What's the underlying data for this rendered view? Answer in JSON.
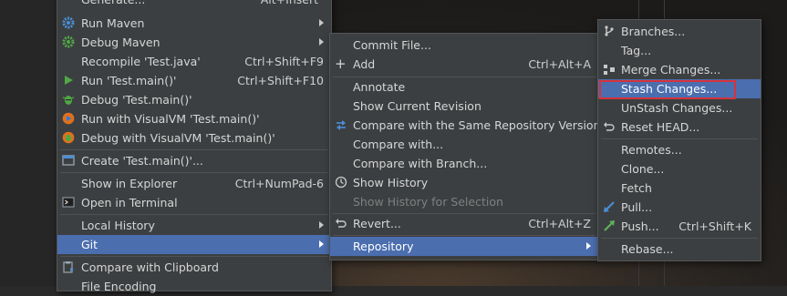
{
  "menu1": {
    "items": [
      {
        "label": "Generate...",
        "shortcut": "Alt+Insert"
      },
      {
        "label": "Run Maven"
      },
      {
        "label": "Debug Maven"
      },
      {
        "label": "Recompile 'Test.java'",
        "shortcut": "Ctrl+Shift+F9"
      },
      {
        "label": "Run 'Test.main()'",
        "shortcut": "Ctrl+Shift+F10"
      },
      {
        "label": "Debug 'Test.main()'"
      },
      {
        "label": "Run with VisualVM 'Test.main()'"
      },
      {
        "label": "Debug with VisualVM 'Test.main()'"
      },
      {
        "label": "Create 'Test.main()'..."
      },
      {
        "label": "Show in Explorer",
        "shortcut": "Ctrl+NumPad-6"
      },
      {
        "label": "Open in Terminal"
      },
      {
        "label": "Local History"
      },
      {
        "label": "Git"
      },
      {
        "label": "Compare with Clipboard"
      },
      {
        "label": "File Encoding"
      }
    ]
  },
  "menu2": {
    "items": [
      {
        "label": "Commit File..."
      },
      {
        "label": "Add",
        "shortcut": "Ctrl+Alt+A"
      },
      {
        "label": "Annotate"
      },
      {
        "label": "Show Current Revision"
      },
      {
        "label": "Compare with the Same Repository Version"
      },
      {
        "label": "Compare with..."
      },
      {
        "label": "Compare with Branch..."
      },
      {
        "label": "Show History"
      },
      {
        "label": "Show History for Selection"
      },
      {
        "label": "Revert...",
        "shortcut": "Ctrl+Alt+Z"
      },
      {
        "label": "Repository"
      }
    ]
  },
  "menu3": {
    "items": [
      {
        "label": "Branches..."
      },
      {
        "label": "Tag..."
      },
      {
        "label": "Merge Changes..."
      },
      {
        "label": "Stash Changes..."
      },
      {
        "label": "UnStash Changes..."
      },
      {
        "label": "Reset HEAD..."
      },
      {
        "label": "Remotes..."
      },
      {
        "label": "Clone..."
      },
      {
        "label": "Fetch"
      },
      {
        "label": "Pull..."
      },
      {
        "label": "Push...",
        "shortcut": "Ctrl+Shift+K"
      },
      {
        "label": "Rebase..."
      }
    ]
  },
  "colors": {
    "menu_bg": "#3c3f41",
    "selection": "#4b6eaf",
    "highlight_box": "#d6323a",
    "run_green": "#4fa845",
    "pull_blue": "#4a8fd8",
    "push_green": "#5fb35a"
  }
}
